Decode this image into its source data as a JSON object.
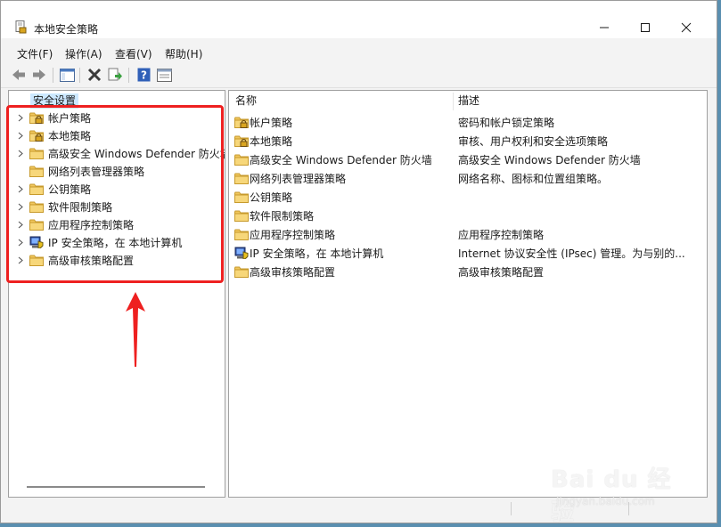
{
  "window": {
    "title": "本地安全策略"
  },
  "menu": [
    "文件(F)",
    "操作(A)",
    "查看(V)",
    "帮助(H)"
  ],
  "toolbar": {
    "buttons": [
      "back-icon",
      "forward-icon",
      "show-hide-tree-icon",
      "delete-icon",
      "export-icon",
      "help-icon",
      "properties-icon"
    ]
  },
  "tree": {
    "root": "安全设置",
    "items": [
      {
        "label": "帐户策略",
        "icon": "folder-lock",
        "expandable": true
      },
      {
        "label": "本地策略",
        "icon": "folder-lock",
        "expandable": true
      },
      {
        "label": "高级安全 Windows Defender 防火墙",
        "icon": "folder",
        "expandable": true
      },
      {
        "label": "网络列表管理器策略",
        "icon": "folder",
        "expandable": false
      },
      {
        "label": "公钥策略",
        "icon": "folder",
        "expandable": true
      },
      {
        "label": "软件限制策略",
        "icon": "folder",
        "expandable": true
      },
      {
        "label": "应用程序控制策略",
        "icon": "folder",
        "expandable": true
      },
      {
        "label": "IP 安全策略，在 本地计算机",
        "icon": "ip-security",
        "expandable": true
      },
      {
        "label": "高级审核策略配置",
        "icon": "folder",
        "expandable": true
      }
    ]
  },
  "list": {
    "columns": [
      "名称",
      "描述"
    ],
    "rows": [
      {
        "name": "帐户策略",
        "desc": "密码和帐户锁定策略",
        "icon": "folder-lock"
      },
      {
        "name": "本地策略",
        "desc": "审核、用户权利和安全选项策略",
        "icon": "folder-lock"
      },
      {
        "name": "高级安全 Windows Defender 防火墙",
        "desc": "高级安全 Windows Defender 防火墙",
        "icon": "folder"
      },
      {
        "name": "网络列表管理器策略",
        "desc": "网络名称、图标和位置组策略。",
        "icon": "folder"
      },
      {
        "name": "公钥策略",
        "desc": "",
        "icon": "folder"
      },
      {
        "name": "软件限制策略",
        "desc": "",
        "icon": "folder"
      },
      {
        "name": "应用程序控制策略",
        "desc": "应用程序控制策略",
        "icon": "folder"
      },
      {
        "name": "IP 安全策略，在 本地计算机",
        "desc": "Internet 协议安全性 (IPsec) 管理。为与别的...",
        "icon": "ip-security"
      },
      {
        "name": "高级审核策略配置",
        "desc": "高级审核策略配置",
        "icon": "folder"
      }
    ]
  },
  "watermark": {
    "main": "Bai du 经验",
    "sub": "jingyan.baidu.com"
  },
  "colors": {
    "highlight": "#ee2020",
    "selection": "#cce8ff",
    "folder": "#f0c75e"
  }
}
